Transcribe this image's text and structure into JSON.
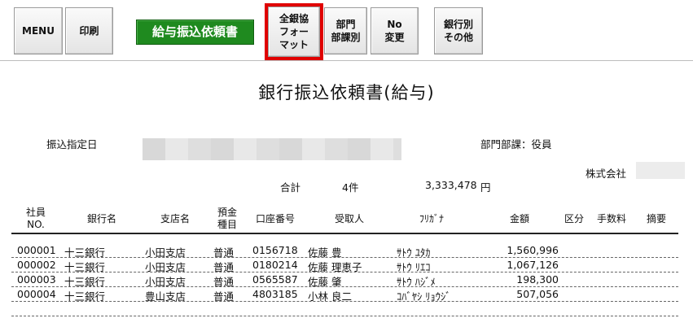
{
  "toolbar": {
    "menu": "MENU",
    "print": "印刷",
    "salary_transfer": "給与振込依頼書",
    "zengin_format": "全銀協\nフォー\nマット",
    "dept_section": "部門\n部課別",
    "no_change": "No\n変更",
    "bank_other": "銀行別\nその他"
  },
  "document": {
    "title": "銀行振込依頼書(給与)",
    "transfer_date_label": "振込指定日",
    "dept_label": "部門部課：役員",
    "company_label": "株式会社",
    "total_label": "合計",
    "total_count": "4件",
    "total_amount": "3,333,478",
    "currency": "円"
  },
  "columns": {
    "employee_no": "社員\nNO.",
    "bank": "銀行名",
    "branch": "支店名",
    "deposit_type": "預金\n種目",
    "account": "口座番号",
    "payee": "受取人",
    "kana": "ﾌﾘｶﾞﾅ",
    "amount": "金額",
    "category": "区分",
    "fee": "手数料",
    "note": "摘要"
  },
  "rows": [
    {
      "no": "000001",
      "bank": "十三銀行",
      "branch": "小田支店",
      "type": "普通",
      "account": "0156718",
      "payee": "佐藤 豊",
      "kana": "ｻﾄｳ ﾕﾀｶ",
      "amount": "1,560,996"
    },
    {
      "no": "000002",
      "bank": "十三銀行",
      "branch": "小田支店",
      "type": "普通",
      "account": "0180214",
      "payee": "佐藤 理恵子",
      "kana": "ｻﾄｳ ﾘｴｺ",
      "amount": "1,067,126"
    },
    {
      "no": "000003",
      "bank": "十三銀行",
      "branch": "小田支店",
      "type": "普通",
      "account": "0565587",
      "payee": "佐藤 肇",
      "kana": "ｻﾄｳ ﾊｼﾞﾒ",
      "amount": "198,300"
    },
    {
      "no": "000004",
      "bank": "十三銀行",
      "branch": "豊山支店",
      "type": "普通",
      "account": "4803185",
      "payee": "小林 良二",
      "kana": "ｺﾊﾞﾔｼ ﾘｮｳｼﾞ",
      "amount": "507,056"
    }
  ],
  "colors": {
    "accent_green": "#1f8a1f",
    "highlight_red": "#e00000"
  }
}
